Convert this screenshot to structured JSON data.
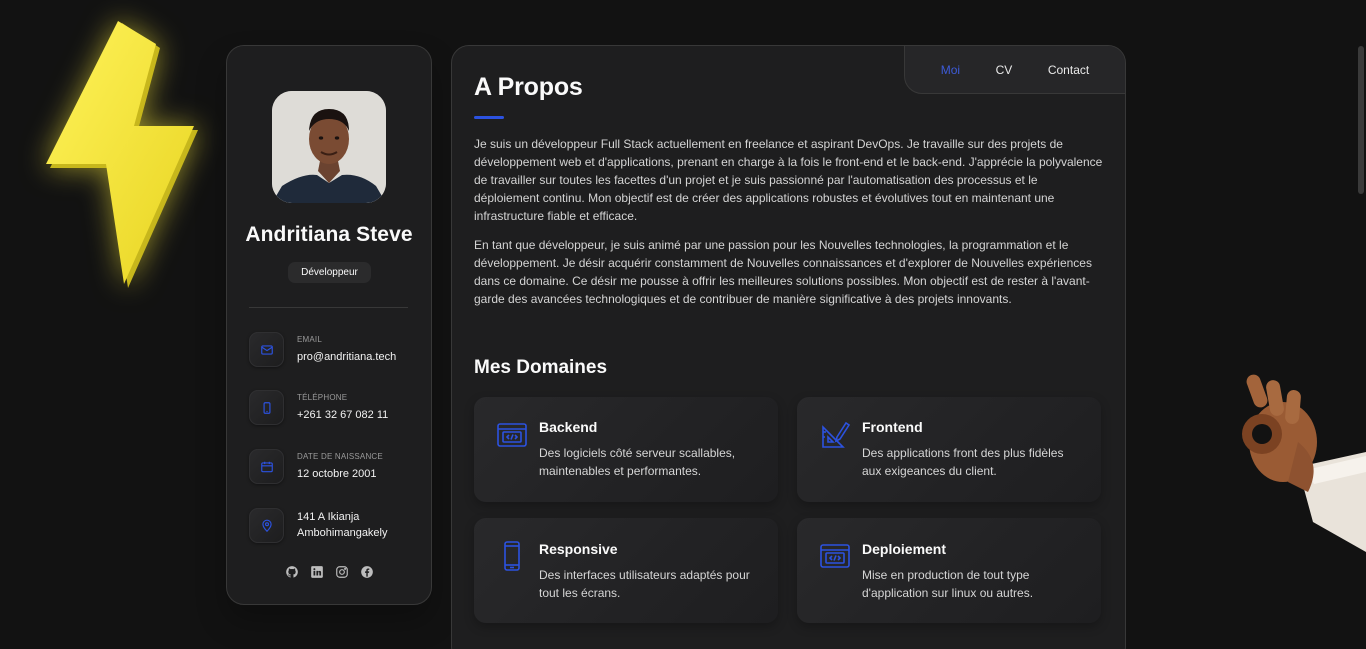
{
  "profile": {
    "name": "Andritiana Steve",
    "title": "Développeur"
  },
  "contacts": [
    {
      "icon": "mail-icon",
      "label": "Email",
      "value": "pro@andritiana.tech"
    },
    {
      "icon": "phone-icon",
      "label": "Téléphone",
      "value": "+261 32 67 082 11"
    },
    {
      "icon": "calendar-icon",
      "label": "Date de naissance",
      "value": "12 octobre 2001"
    },
    {
      "icon": "location-icon",
      "label": "",
      "value": "141 A Ikianja Ambohimangakely"
    }
  ],
  "socials": [
    "github-icon",
    "linkedin-icon",
    "instagram-icon",
    "facebook-icon"
  ],
  "nav": {
    "items": [
      "Moi",
      "CV",
      "Contact"
    ],
    "active": "Moi"
  },
  "about": {
    "heading": "A Propos",
    "paragraphs": [
      "Je suis un développeur Full Stack actuellement en freelance et aspirant DevOps. Je travaille sur des projets de développement web et d'applications, prenant en charge à la fois le front-end et le back-end. J'apprécie la polyvalence de travailler sur toutes les facettes d'un projet et je suis passionné par l'automatisation des processus et le déploiement continu. Mon objectif est de créer des applications robustes et évolutives tout en maintenant une infrastructure fiable et efficace.",
      "En tant que développeur, je suis animé par une passion pour les Nouvelles technologies, la programmation et le développement. Je désir acquérir constamment de Nouvelles connaissances et d'explorer de Nouvelles expériences dans ce domaine. Ce désir me pousse à offrir les meilleures solutions possibles. Mon objectif est de rester à l'avant-garde des avancées technologiques et de contribuer de manière significative à des projets innovants."
    ]
  },
  "domains": {
    "heading": "Mes Domaines",
    "items": [
      {
        "icon": "code-window-icon",
        "title": "Backend",
        "description": "Des logiciels côté serveur scallables, maintenables et performantes."
      },
      {
        "icon": "design-icon",
        "title": "Frontend",
        "description": "Des applications front des plus fidèles aux exigeances du client."
      },
      {
        "icon": "mobile-phone-icon",
        "title": "Responsive",
        "description": "Des interfaces utilisateurs adaptés pour tout les écrans."
      },
      {
        "icon": "code-window-icon",
        "title": "Deploiement",
        "description": "Mise en production de tout type d'application sur linux ou autres."
      }
    ]
  },
  "colors": {
    "background": "#121212",
    "panel": "#1e1e1f",
    "accent": "#2c52e0",
    "nav_active": "#3d5bd9",
    "bolt": "#ffee3c"
  }
}
